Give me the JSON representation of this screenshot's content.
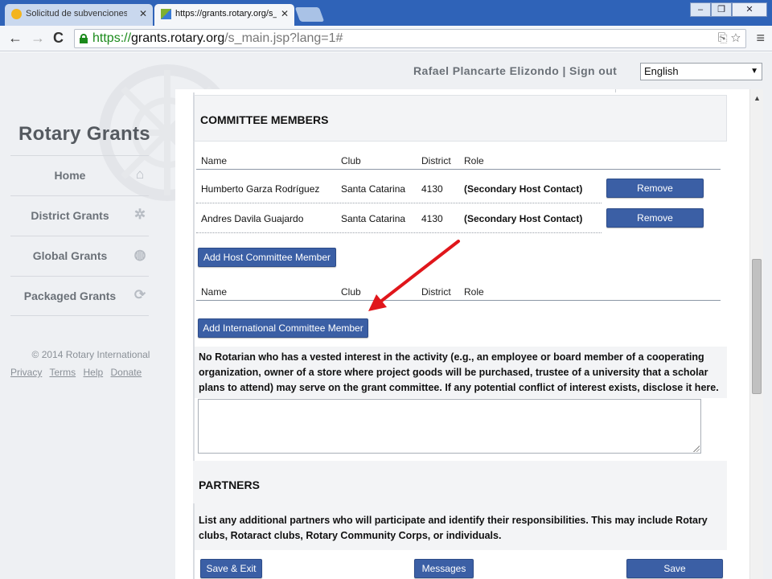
{
  "browser": {
    "tabs": [
      {
        "title": "Solicitud de subvenciones | M",
        "active": false
      },
      {
        "title": "https://grants.rotary.org/s_",
        "active": true
      }
    ],
    "tab_close_glyph": "✕",
    "window_buttons": {
      "minimize": "–",
      "maximize": "❐",
      "close": "✕"
    },
    "nav": {
      "back": "←",
      "forward": "→",
      "reload": "C"
    },
    "url": {
      "scheme": "https://",
      "host": "grants.rotary.org",
      "path": "/s_main.jsp?lang=1#"
    },
    "omnibox_icons": "⎘ ☆",
    "menu_glyph": "≡"
  },
  "header": {
    "user_text": "Rafael Plancarte Elizondo | Sign out",
    "language": "English",
    "select_arrow": "▼"
  },
  "sidebar": {
    "brand": "Rotary Grants",
    "items": [
      {
        "label": "Home",
        "icon": "home-icon",
        "glyph": "⌂"
      },
      {
        "label": "District Grants",
        "icon": "gear-icon",
        "glyph": "✲"
      },
      {
        "label": "Global Grants",
        "icon": "globe-icon",
        "glyph": "◍"
      },
      {
        "label": "Packaged Grants",
        "icon": "refresh-icon",
        "glyph": "⟳"
      }
    ],
    "copyright": "© 2014 Rotary International",
    "links": [
      "Privacy",
      "Terms",
      "Help",
      "Donate"
    ]
  },
  "committee": {
    "title": "COMMITTEE MEMBERS",
    "columns": [
      "Name",
      "Club",
      "District",
      "Role"
    ],
    "host_members": [
      {
        "name": "Humberto Garza Rodríguez",
        "club": "Santa Catarina",
        "district": "4130",
        "role": "(Secondary Host Contact)",
        "action": "Remove"
      },
      {
        "name": "Andres Davila Guajardo",
        "club": "Santa Catarina",
        "district": "4130",
        "role": "(Secondary Host Contact)",
        "action": "Remove"
      }
    ],
    "add_host_label": "Add Host Committee Member",
    "add_international_label": "Add International Committee Member",
    "conflict_notice": "No Rotarian who has a vested interest in the activity (e.g., an employee or board member of a cooperating organization, owner of a store where project goods will be purchased, trustee of a university that a scholar plans to attend) may serve on the grant committee. If any potential conflict of interest exists, disclose it here.",
    "disclosure_value": ""
  },
  "partners": {
    "title": "PARTNERS",
    "description": "List any additional partners who will participate and identify their responsibilities. This may include Rotary clubs, Rotaract clubs, Rotary Community Corps, or individuals."
  },
  "footer": {
    "save_exit": "Save & Exit",
    "messages": "Messages",
    "save": "Save"
  },
  "annotation": {
    "color": "#e0161b",
    "points_to": "Add International Committee Member"
  },
  "colors": {
    "button": "#3b5fa5",
    "tabstrip": "#2f63b8"
  }
}
